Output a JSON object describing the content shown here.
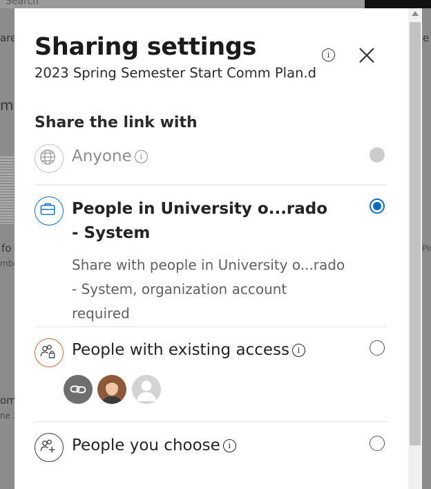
{
  "background": {
    "search_text": "Search",
    "fragments": [
      "are",
      "m",
      "fo",
      "mbe",
      "om",
      "ne 2",
      "e",
      "Pin"
    ]
  },
  "dialog": {
    "title": "Sharing settings",
    "file_name": "2023 Spring Semester Start Comm Plan.d",
    "info_glyph": "i",
    "section_label": "Share the link with",
    "options": [
      {
        "title": "Anyone",
        "icon": "globe-icon",
        "state": "disabled"
      },
      {
        "title": "People in University o...rado - System",
        "description": "Share with people in University o...rado - System, organization account required",
        "icon": "briefcase-icon",
        "state": "selected"
      },
      {
        "title": "People with existing access",
        "icon": "people-lock-icon",
        "state": "unselected",
        "avatars": [
          "link-avatar-icon",
          "user-photo-avatar",
          "default-user-avatar-icon"
        ]
      },
      {
        "title": "People you choose",
        "icon": "people-add-icon",
        "state": "unselected"
      }
    ]
  },
  "colors": {
    "accent": "#0f6cbd",
    "disabled": "#cccccc",
    "icon_border_orange": "#c06a3b"
  }
}
